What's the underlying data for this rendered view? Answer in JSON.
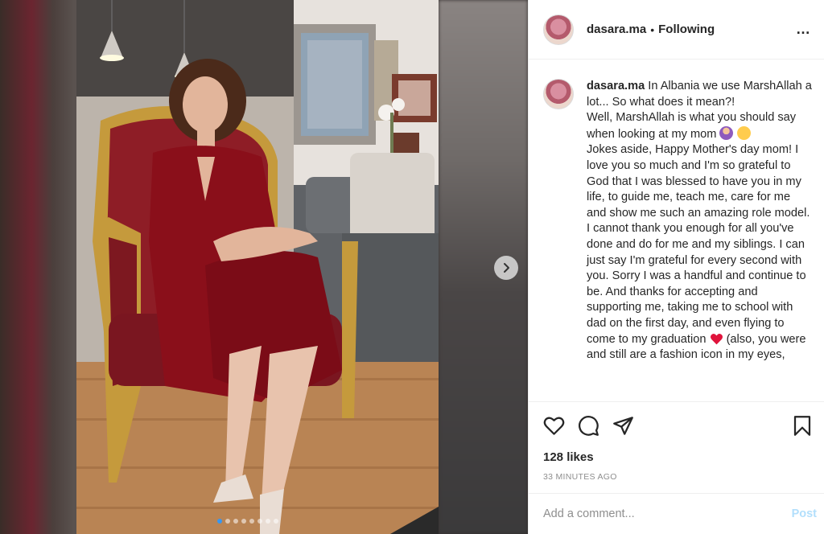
{
  "header": {
    "username": "dasara.ma",
    "separator": "•",
    "follow_status": "Following",
    "more_icon": "…"
  },
  "caption": {
    "username": "dasara.ma",
    "line1": " In Albania we use MarshAllah a lot... So what does it mean?!",
    "line2": "Well, MarshAllah is what you should say when looking at my mom ",
    "line3": "Jokes aside, Happy Mother's day mom! I love you so much and I'm so grateful to God that I was blessed to have you in my life, to guide me, teach me, care for me and show me such an amazing role model. I cannot thank you enough for all you've done and do for me and my siblings. I can just say I'm grateful for every second with you. Sorry I was a handful and continue to be. And thanks for accepting and supporting me, taking me to school with dad on the first day, and even flying to come to my graduation ",
    "line4": " (also, you were and still are a fashion icon in my eyes,"
  },
  "icons": {
    "like": "heart-icon",
    "comment": "comment-icon",
    "share": "share-icon",
    "save": "bookmark-icon",
    "next": "chevron-right-icon"
  },
  "stats": {
    "likes": "128 likes",
    "time": "33 MINUTES AGO"
  },
  "comment": {
    "placeholder": "Add a comment...",
    "post_label": "Post"
  },
  "carousel": {
    "slide_count": 8,
    "active_index": 0
  },
  "colors": {
    "accent": "#3897f0",
    "post_disabled": "#b2dffc",
    "text": "#262626",
    "muted": "#8e8e8e"
  }
}
